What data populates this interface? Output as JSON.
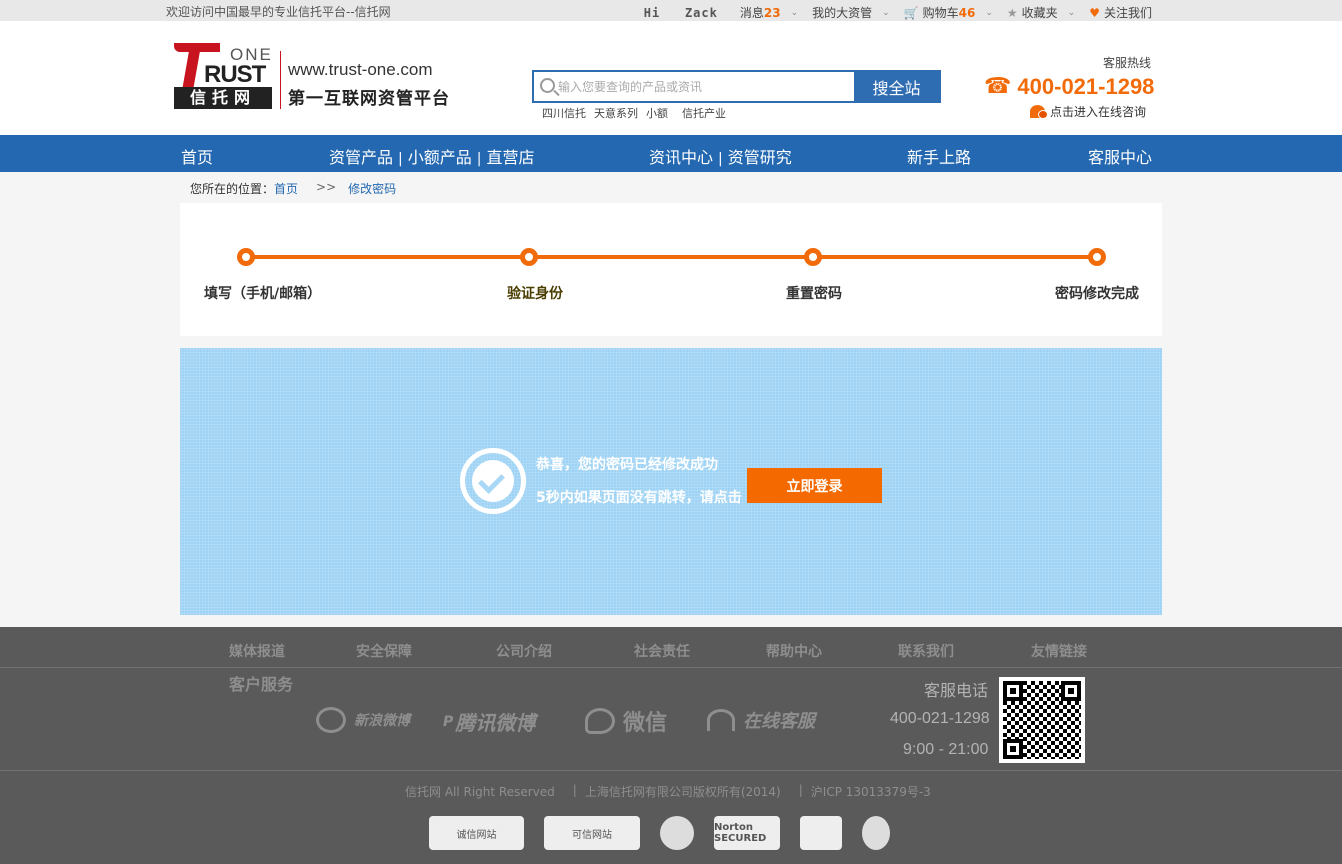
{
  "topbar": {
    "welcome": "欢迎访问中国最早的专业信托平台--信托网",
    "greeting": "Hi",
    "username": "Zack",
    "messages_label": "消息",
    "messages_count": "23",
    "my_assets": "我的大资管",
    "cart_label": "购物车",
    "cart_count": "46",
    "favorites": "收藏夹",
    "follow": "关注我们"
  },
  "header": {
    "logo_one": "ONE",
    "logo_rust": "RUST",
    "logo_cn": "信托网",
    "site_url": "www.trust-one.com",
    "slogan": "第一互联网资管平台",
    "search_placeholder": "输入您要查询的产品或资讯",
    "search_button": "搜全站",
    "hot_words": [
      "四川信托",
      "天意系列",
      "小额",
      "信托产业"
    ],
    "hotline_label": "客服热线",
    "hotline": "400-021-1298",
    "online_consult": "点击进入在线咨询"
  },
  "nav": {
    "home": "首页",
    "products": "资管产品",
    "small_products": "小额产品",
    "direct_store": "直营店",
    "news": "资讯中心",
    "research": "资管研究",
    "newbie": "新手上路",
    "service": "客服中心"
  },
  "breadcrumb": {
    "prefix": "您所在的位置：",
    "home": "首页",
    "separator": ">>",
    "current": "修改密码"
  },
  "steps": [
    {
      "label": "填写（手机/邮箱）"
    },
    {
      "label": "验证身份"
    },
    {
      "label": "重置密码"
    },
    {
      "label": "密码修改完成"
    }
  ],
  "success": {
    "line1": "恭喜，您的密码已经修改成功",
    "line2": "5秒内如果页面没有跳转，请点击",
    "login_button": "立即登录"
  },
  "footer": {
    "links": [
      "媒体报道",
      "安全保障",
      "公司介绍",
      "社会责任",
      "帮助中心",
      "联系我们",
      "友情链接"
    ],
    "service_title": "客户服务",
    "services": [
      "新浪微博",
      "腾讯微博",
      "微信",
      "在线客服"
    ],
    "contact_label": "客服电话",
    "contact_phone": "400-021-1298",
    "contact_hours": "9:00 - 21:00",
    "copyright_1": "信托网 All Right Reserved",
    "copyright_2": "上海信托网有限公司版权所有(2014)",
    "copyright_3": "沪ICP 13013379号-3",
    "badges": [
      "诚信网站",
      "可信网站",
      "Norton SECURED"
    ]
  },
  "colors": {
    "accent_orange": "#f26b0a",
    "nav_blue": "#2368b0",
    "panel_blue": "#9fd3f4",
    "footer_gray": "#5a5a5a"
  }
}
